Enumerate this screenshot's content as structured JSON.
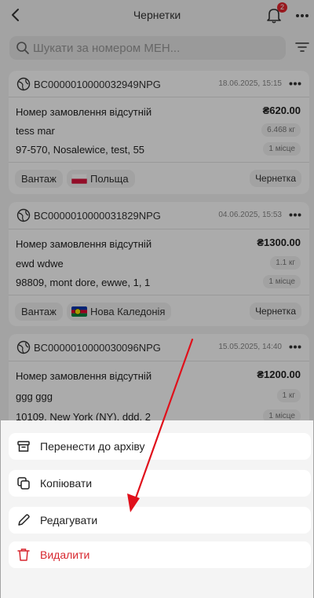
{
  "header": {
    "title": "Чернетки",
    "notification_count": "2"
  },
  "search": {
    "placeholder": "Шукати за номером МЕН..."
  },
  "cards": [
    {
      "tracking": "BC0000010000032949NPG",
      "date": "18.06.2025, 15:15",
      "order": "Номер замовлення відсутній",
      "price": "₴620.00",
      "recipient": "tess mar",
      "weight": "6.468 кг",
      "address": "97-570, Nosalewice, test, 55",
      "places": "1 місце",
      "tag": "Вантаж",
      "country": "Польща",
      "status": "Чернетка"
    },
    {
      "tracking": "BC0000010000031829NPG",
      "date": "04.06.2025, 15:53",
      "order": "Номер замовлення відсутній",
      "price": "₴1300.00",
      "recipient": "ewd wdwe",
      "weight": "1.1 кг",
      "address": "98809, mont dore, ewwe, 1, 1",
      "places": "1 місце",
      "tag": "Вантаж",
      "country": "Нова Каледонія",
      "status": "Чернетка"
    },
    {
      "tracking": "BC0000010000030096NPG",
      "date": "15.05.2025, 14:40",
      "order": "Номер замовлення відсутній",
      "price": "₴1200.00",
      "recipient": "ggg ggg",
      "weight": "1 кг",
      "address": "10109, New York (NY), ddd, 2",
      "places": "1 місце"
    }
  ],
  "actions": [
    {
      "label": "Перенести до архіву",
      "icon": "archive-icon"
    },
    {
      "label": "Копіювати",
      "icon": "copy-icon"
    },
    {
      "label": "Редагувати",
      "icon": "pencil-icon"
    },
    {
      "label": "Видалити",
      "icon": "trash-icon"
    }
  ],
  "colors": {
    "accent": "#e3262e",
    "danger": "#d7262e",
    "arrow": "#e0101b"
  }
}
